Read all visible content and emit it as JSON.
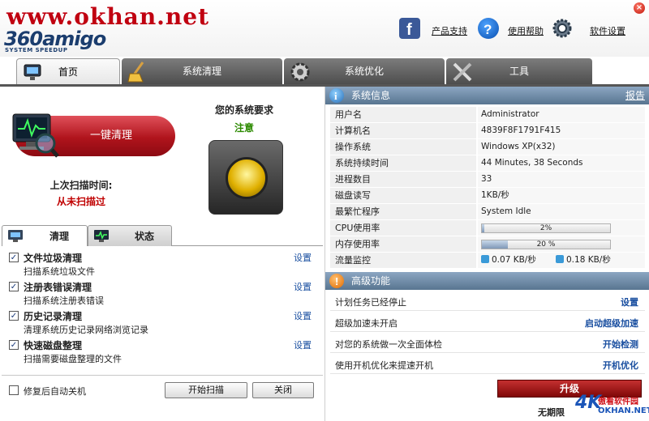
{
  "watermark": "www.okhan.net",
  "brand": {
    "name": "360amigo",
    "sub": "SYSTEM SPEEDUP"
  },
  "header_links": {
    "support": "产品支持",
    "help": "使用帮助",
    "settings": "软件设置"
  },
  "tabs": [
    {
      "label": "首页",
      "active": true
    },
    {
      "label": "系统清理",
      "active": false
    },
    {
      "label": "系统优化",
      "active": false
    },
    {
      "label": "工具",
      "active": false
    }
  ],
  "home": {
    "clean_button": "一键清理",
    "last_scan_label": "上次扫描时间:",
    "last_scan_value": "从未扫描过",
    "requirements_title": "您的系统要求",
    "requirements_status": "注意"
  },
  "subtabs": [
    {
      "label": "清理",
      "active": true
    },
    {
      "label": "状态",
      "active": false
    }
  ],
  "clean_items": [
    {
      "title": "文件垃圾清理",
      "desc": "扫描系统垃圾文件",
      "setting": "设置",
      "checked": true
    },
    {
      "title": "注册表错误清理",
      "desc": "扫描系统注册表错误",
      "setting": "设置",
      "checked": true
    },
    {
      "title": "历史记录清理",
      "desc": "清理系统历史记录网络浏览记录",
      "setting": "设置",
      "checked": true
    },
    {
      "title": "快速磁盘整理",
      "desc": "扫描需要磁盘整理的文件",
      "setting": "设置",
      "checked": true
    }
  ],
  "bottom": {
    "shutdown_label": "修复后自动关机",
    "scan_button": "开始扫描",
    "close_button": "关闭"
  },
  "system_info": {
    "title": "系统信息",
    "report_link": "报告",
    "rows": [
      {
        "key": "用户名",
        "value": "Administrator"
      },
      {
        "key": "计算机名",
        "value": "4839F8F1791F415"
      },
      {
        "key": "操作系统",
        "value": "Windows XP(x32)"
      },
      {
        "key": "系统持续时间",
        "value": "44 Minutes, 38 Seconds"
      },
      {
        "key": "进程数目",
        "value": "33"
      },
      {
        "key": "磁盘读写",
        "value": "1KB/秒"
      },
      {
        "key": "最繁忙程序",
        "value": "System Idle"
      }
    ],
    "cpu": {
      "key": "CPU使用率",
      "text": "2%",
      "percent": 2
    },
    "memory": {
      "key": "内存使用率",
      "text": "20 %",
      "percent": 20
    },
    "traffic": {
      "key": "流量监控",
      "up": "0.07 KB/秒",
      "down": "0.18 KB/秒"
    }
  },
  "advanced": {
    "title": "高级功能",
    "rows": [
      {
        "text": "计划任务已经停止",
        "link": "设置"
      },
      {
        "text": "超级加速未开启",
        "link": "启动超级加速"
      },
      {
        "text": "对您的系统做一次全面体检",
        "link": "开始检测"
      },
      {
        "text": "使用开机优化来提速开机",
        "link": "开机优化"
      }
    ]
  },
  "upgrade_button": "升级",
  "unlimited_text": "无期限",
  "site_logo": {
    "mark": "4K",
    "line1": "傲看软件园",
    "line2": "OKHAN.NET"
  },
  "colors": {
    "accent_red": "#b0141c",
    "status_green": "#2c8a00",
    "link_blue": "#1a4fa0",
    "section_blue": "#587590"
  }
}
